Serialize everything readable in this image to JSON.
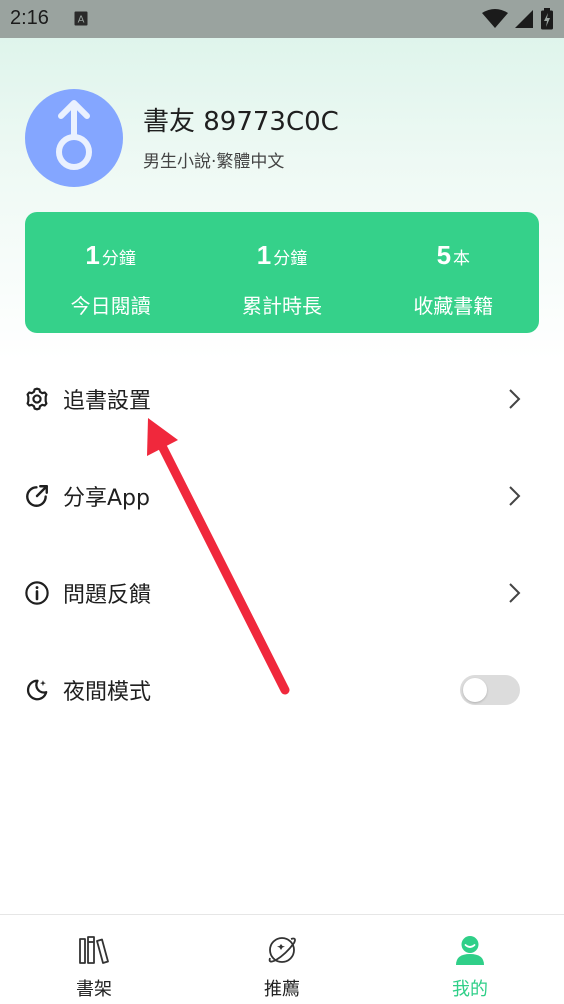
{
  "status_bar": {
    "time": "2:16",
    "notification_letter": "A"
  },
  "profile": {
    "username": "書友 89773C0C",
    "subtitle": "男生小說·繁體中文"
  },
  "stats": [
    {
      "value": "1",
      "unit": "分鐘",
      "label": "今日閱讀"
    },
    {
      "value": "1",
      "unit": "分鐘",
      "label": "累計時長"
    },
    {
      "value": "5",
      "unit": "本",
      "label": "收藏書籍"
    }
  ],
  "menu": {
    "settings": "追書設置",
    "share": "分享App",
    "feedback": "問題反饋",
    "night_mode": "夜間模式",
    "night_mode_on": false
  },
  "bottom_nav": {
    "bookshelf": "書架",
    "recommend": "推薦",
    "mine": "我的",
    "active": "mine"
  },
  "colors": {
    "accent": "#35d18a",
    "avatar": "#84a6ff",
    "annotation": "#f0283c"
  }
}
